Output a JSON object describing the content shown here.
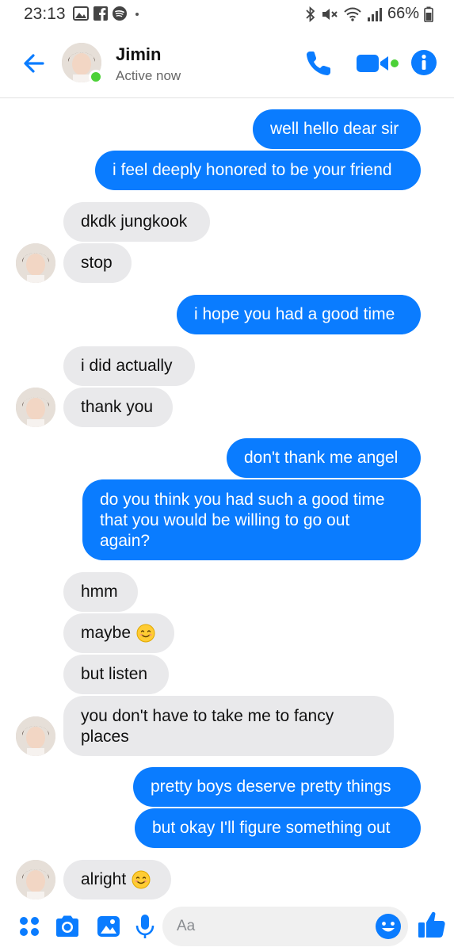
{
  "status_bar": {
    "time": "23:13",
    "battery": "66%",
    "icons": [
      "gallery-icon",
      "facebook-icon",
      "spotify-icon",
      "dot-icon",
      "bluetooth-icon",
      "mute-icon",
      "wifi-icon",
      "signal-icon",
      "battery-icon"
    ]
  },
  "header": {
    "contact_name": "Jimin",
    "status": "Active now",
    "online_color": "#4cd137"
  },
  "colors": {
    "accent": "#0a7cff",
    "incoming_bubble": "#e9e9eb"
  },
  "messages": [
    {
      "side": "out",
      "text": "well hello dear sir"
    },
    {
      "side": "out",
      "text": "i feel deeply honored to be your friend"
    },
    {
      "side": "in",
      "text": "dkdk jungkook"
    },
    {
      "side": "in",
      "text": "stop"
    },
    {
      "side": "out",
      "text": "i hope you had a good time"
    },
    {
      "side": "in",
      "text": "i did actually"
    },
    {
      "side": "in",
      "text": "thank you"
    },
    {
      "side": "out",
      "text": "don't thank me angel"
    },
    {
      "side": "out",
      "text": "do you think you had such a good time that you would be willing to go out again?"
    },
    {
      "side": "in",
      "text": "hmm"
    },
    {
      "side": "in",
      "text": "maybe",
      "emoji": "smiling-face-emoji"
    },
    {
      "side": "in",
      "text": "but listen"
    },
    {
      "side": "in",
      "text": "you don't have to take me to fancy places"
    },
    {
      "side": "out",
      "text": "pretty boys deserve pretty things"
    },
    {
      "side": "out",
      "text": "but okay I'll figure something out"
    },
    {
      "side": "in",
      "text": "alright",
      "emoji": "smiling-face-emoji"
    }
  ],
  "composer": {
    "placeholder": "Aa",
    "icons": [
      "apps-icon",
      "camera-icon",
      "image-icon",
      "microphone-icon",
      "emoji-icon",
      "thumbs-up-icon"
    ]
  }
}
